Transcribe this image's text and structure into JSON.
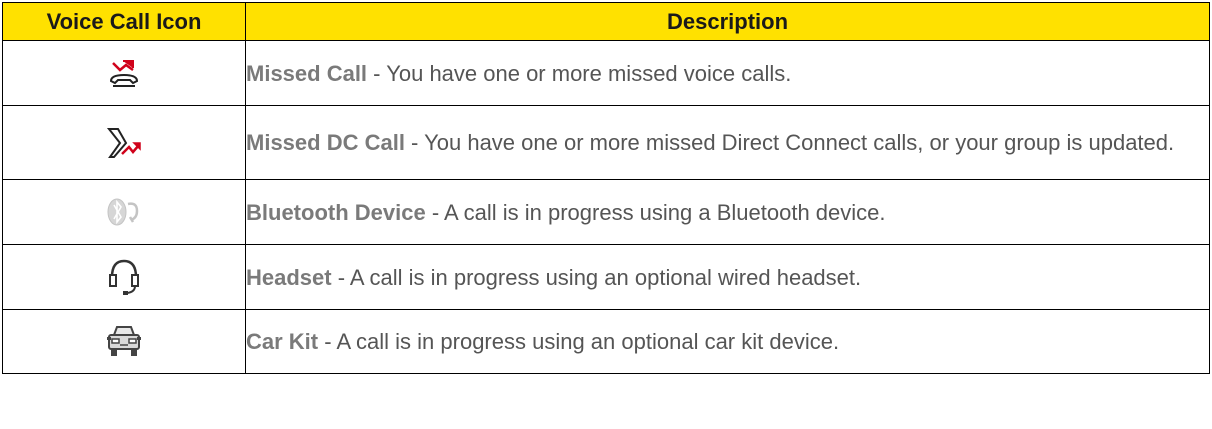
{
  "table": {
    "headers": [
      "Voice Call Icon",
      "Description"
    ],
    "rows": [
      {
        "icon": "missed-call-icon",
        "title": "Missed Call",
        "text": " - You have one or more missed voice calls."
      },
      {
        "icon": "missed-dc-call-icon",
        "title": "Missed DC Call",
        "text": " - You have one or more missed Direct Connect calls, or your group is updated."
      },
      {
        "icon": "bluetooth-device-icon",
        "title": "Bluetooth Device",
        "text": " - A call is in progress using a Bluetooth device."
      },
      {
        "icon": "headset-icon",
        "title": "Headset",
        "text": " - A call is in progress using an optional wired headset."
      },
      {
        "icon": "car-kit-icon",
        "title": "Car Kit",
        "text": " - A call is in progress using an optional car kit device."
      }
    ]
  },
  "colors": {
    "header_background": "#ffe100",
    "accent_red": "#d0021b",
    "text_gray": "#555555"
  }
}
